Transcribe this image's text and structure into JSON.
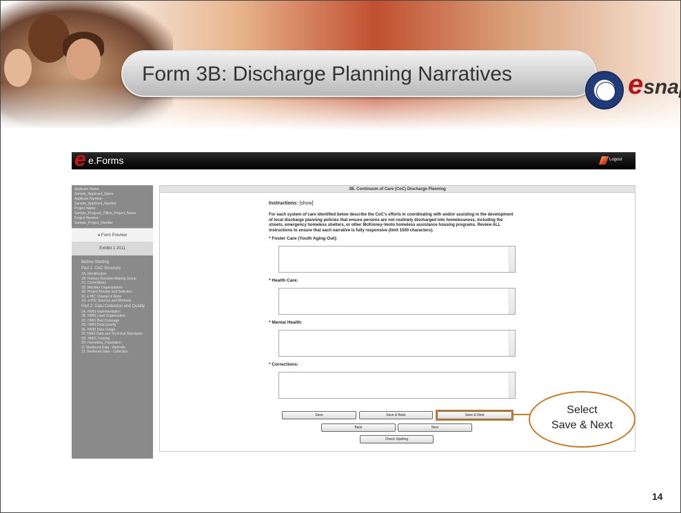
{
  "slide": {
    "title": "Form 3B: Discharge Planning Narratives",
    "logo_text": "snaps",
    "logo_e": "e",
    "page_number": "14"
  },
  "app": {
    "name": "e.Forms",
    "logo_e": "e",
    "logout_label": "Logout"
  },
  "sidebar": {
    "info": [
      "Applicant Name:",
      "Sample_Applicant_Name",
      "Applicant Number:",
      "Sample_Applicant_Number",
      "Project Name:",
      "Sample_Program_Office_Project_Name",
      "Project Number:",
      "Sample_Project_Number"
    ],
    "tab_preview": "e.Form Preview",
    "tab_exhibit": "Exhibit 1 2011",
    "nav": [
      {
        "label": "Before Starting",
        "part": true
      },
      {
        "label": "Part 1: CoC Structure",
        "part": true
      },
      {
        "label": "1A. Identification",
        "part": false
      },
      {
        "label": "1B. Primary Decision-Making Group",
        "part": false
      },
      {
        "label": "1C. Committees",
        "part": false
      },
      {
        "label": "1D. Member Organizations",
        "part": false
      },
      {
        "label": "1E. Project Review and Selection",
        "part": false
      },
      {
        "label": "1F. e-HIC Change in Beds",
        "part": false
      },
      {
        "label": "1G. e-HIC Sources and Methods",
        "part": false
      },
      {
        "label": "Part 2: Data Collection and Quality",
        "part": true
      },
      {
        "label": "2A. HMIS Implementation",
        "part": false
      },
      {
        "label": "2B. HMIS Lead Organization",
        "part": false
      },
      {
        "label": "2C. HMIS Bed Coverage",
        "part": false
      },
      {
        "label": "2D. HMIS Data Quality",
        "part": false
      },
      {
        "label": "2E. HMIS Data Usage",
        "part": false
      },
      {
        "label": "2F. HMIS Data and Technical Standards",
        "part": false
      },
      {
        "label": "2G. HMIS Training",
        "part": false
      },
      {
        "label": "2H. Homeless_Population",
        "part": false
      },
      {
        "label": "2I. Sheltered Data - Methods",
        "part": false
      },
      {
        "label": "2J. Sheltered Data - Collection",
        "part": false
      }
    ]
  },
  "form": {
    "header": "3B. Continuum of Care (CoC) Discharge Planning",
    "instructions_label": "Instructions:",
    "instructions_link": "[show]",
    "paragraph": "For each system of care identified below describe the CoC's efforts in coordinating with and/or assisting in the development of local discharge planning policies that ensure persons are not routinely discharged into homelessness, including the streets, emergency homeless shelters, or other McKinney-Vento homeless assistance housing programs. Review ALL instructions to ensure that each narrative is fully responsive (limit 1500 characters).",
    "questions": [
      "* Foster Care (Youth Aging Out):",
      "* Health Care:",
      "* Mental Health:",
      "* Corrections:"
    ],
    "buttons": {
      "save": "Save",
      "save_back": "Save & Back",
      "save_next": "Save & Next",
      "back": "Back",
      "next": "Next",
      "check_spelling": "Check Spelling"
    }
  },
  "callout": {
    "line1": "Select",
    "line2": "Save & Next"
  },
  "colors": {
    "callout_border": "#c77a2a",
    "brand_red": "#c4161c",
    "sidebar_bg": "#8a8a8a"
  }
}
